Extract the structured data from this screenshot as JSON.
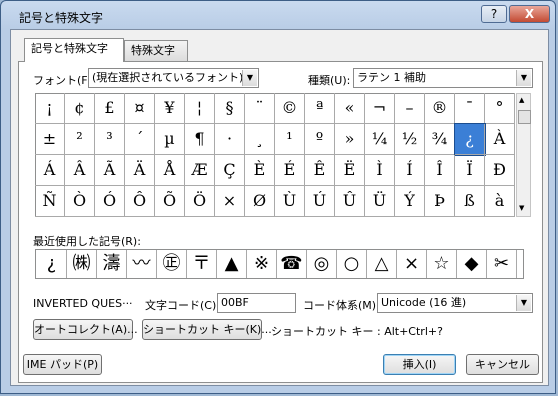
{
  "window": {
    "title": "記号と特殊文字",
    "help_label": "?",
    "close_label": "X"
  },
  "tabs": [
    {
      "label": "記号と特殊文字"
    },
    {
      "label": "特殊文字"
    }
  ],
  "font": {
    "label": "フォント(F):",
    "value": "(現在選択されているフォント)"
  },
  "subset": {
    "label": "種類(U):",
    "value": "ラテン 1 補助"
  },
  "grid": {
    "rows": [
      [
        "¡",
        "¢",
        "£",
        "¤",
        "¥",
        "¦",
        "§",
        "¨",
        "©",
        "ª",
        "«",
        "¬",
        "–",
        "®",
        "¯",
        "°"
      ],
      [
        "±",
        "²",
        "³",
        "´",
        "µ",
        "¶",
        "·",
        "¸",
        "¹",
        "º",
        "»",
        "¼",
        "½",
        "¾",
        "¿",
        "À"
      ],
      [
        "Á",
        "Â",
        "Ã",
        "Ä",
        "Å",
        "Æ",
        "Ç",
        "È",
        "É",
        "Ê",
        "Ë",
        "Ì",
        "Í",
        "Î",
        "Ï",
        "Ð"
      ],
      [
        "Ñ",
        "Ò",
        "Ó",
        "Ô",
        "Õ",
        "Ö",
        "×",
        "Ø",
        "Ù",
        "Ú",
        "Û",
        "Ü",
        "Ý",
        "Þ",
        "ß",
        "à"
      ]
    ],
    "selected": {
      "row": 1,
      "col": 14
    }
  },
  "recent": {
    "label": "最近使用した記号(R):",
    "items": [
      "¿",
      "㈱",
      "濤",
      "〰",
      "㊣",
      "〒",
      "▲",
      "※",
      "☎",
      "◎",
      "○",
      "△",
      "×",
      "☆",
      "◆",
      "✂"
    ]
  },
  "char_name": "INVERTED QUES···",
  "char_code": {
    "label": "文字コード(C):",
    "value": "00BF"
  },
  "code_system": {
    "label": "コード体系(M):",
    "value": "Unicode (16 進)"
  },
  "buttons": {
    "autocorrect": "オートコレクト(A)...",
    "shortcut_key": "ショートカット キー(K)...",
    "ime_pad": "IME パッド(P)",
    "insert": "挿入(I)",
    "cancel": "キャンセル"
  },
  "shortcut_text": "ショートカット キー : Alt+Ctrl+?"
}
